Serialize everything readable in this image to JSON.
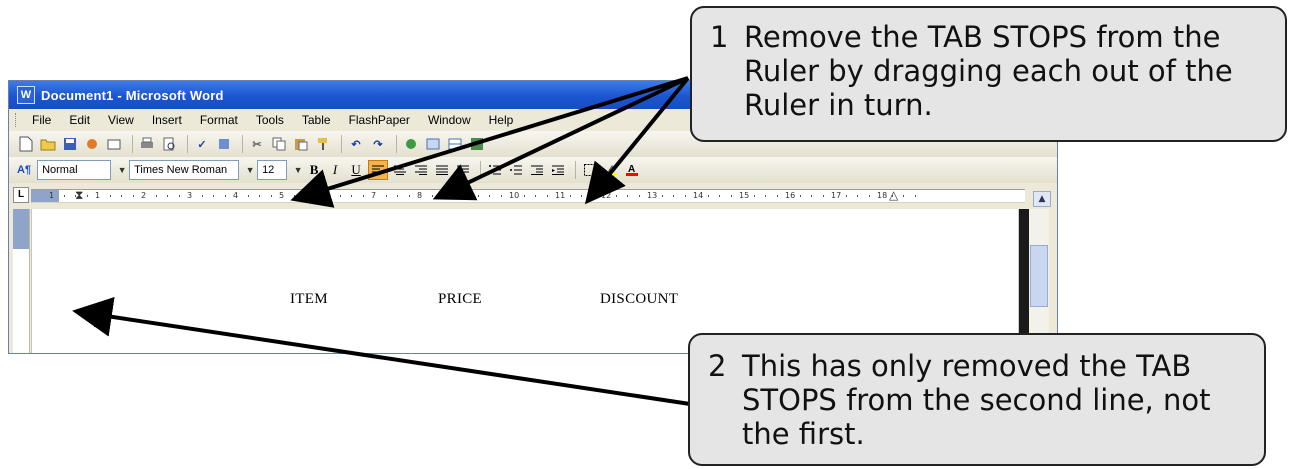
{
  "window": {
    "title": "Document1 - Microsoft Word",
    "app_icon": "word-doc-icon"
  },
  "menu": {
    "items": [
      "File",
      "Edit",
      "View",
      "Insert",
      "Format",
      "Tools",
      "Table",
      "FlashPaper",
      "Window",
      "Help"
    ]
  },
  "standard_toolbar": {
    "buttons": [
      "new-icon",
      "open-icon",
      "save-icon",
      "permission-icon",
      "email-icon",
      "print-icon",
      "print-preview-icon",
      "spelling-icon",
      "research-icon",
      "cut-icon",
      "copy-icon",
      "paste-icon",
      "format-painter-icon",
      "undo-icon",
      "redo-icon",
      "hyperlink-icon",
      "tables-borders-icon",
      "insert-table-icon",
      "insert-excel-icon",
      "columns-icon"
    ]
  },
  "formatting_toolbar": {
    "style_value": "Normal",
    "font_value": "Times New Roman",
    "size_value": "12",
    "bold": "B",
    "italic": "I",
    "underline": "U",
    "align_left_active": true,
    "highlight_color": "#ffff00",
    "font_color": "#ff0000"
  },
  "ruler": {
    "numbers": [
      "1",
      "1",
      "2",
      "3",
      "4",
      "5",
      "6",
      "7",
      "8",
      "9",
      "10",
      "11",
      "12",
      "13",
      "14",
      "15",
      "16",
      "17",
      "18"
    ]
  },
  "document": {
    "headings": [
      "ITEM",
      "PRICE",
      "DISCOUNT"
    ]
  },
  "callouts": {
    "first": {
      "number": "1",
      "text": "Remove the TAB STOPS from the Ruler by dragging each out of the Ruler in turn."
    },
    "second": {
      "number": "2",
      "text": "This has only removed the TAB STOPS from the second line, not the first."
    }
  },
  "colors": {
    "title_bar": "#1b55d2",
    "toolbar_bg": "#ece9d8",
    "callout_bg": "#e5e5e5",
    "active_button": "#f6b34b"
  }
}
